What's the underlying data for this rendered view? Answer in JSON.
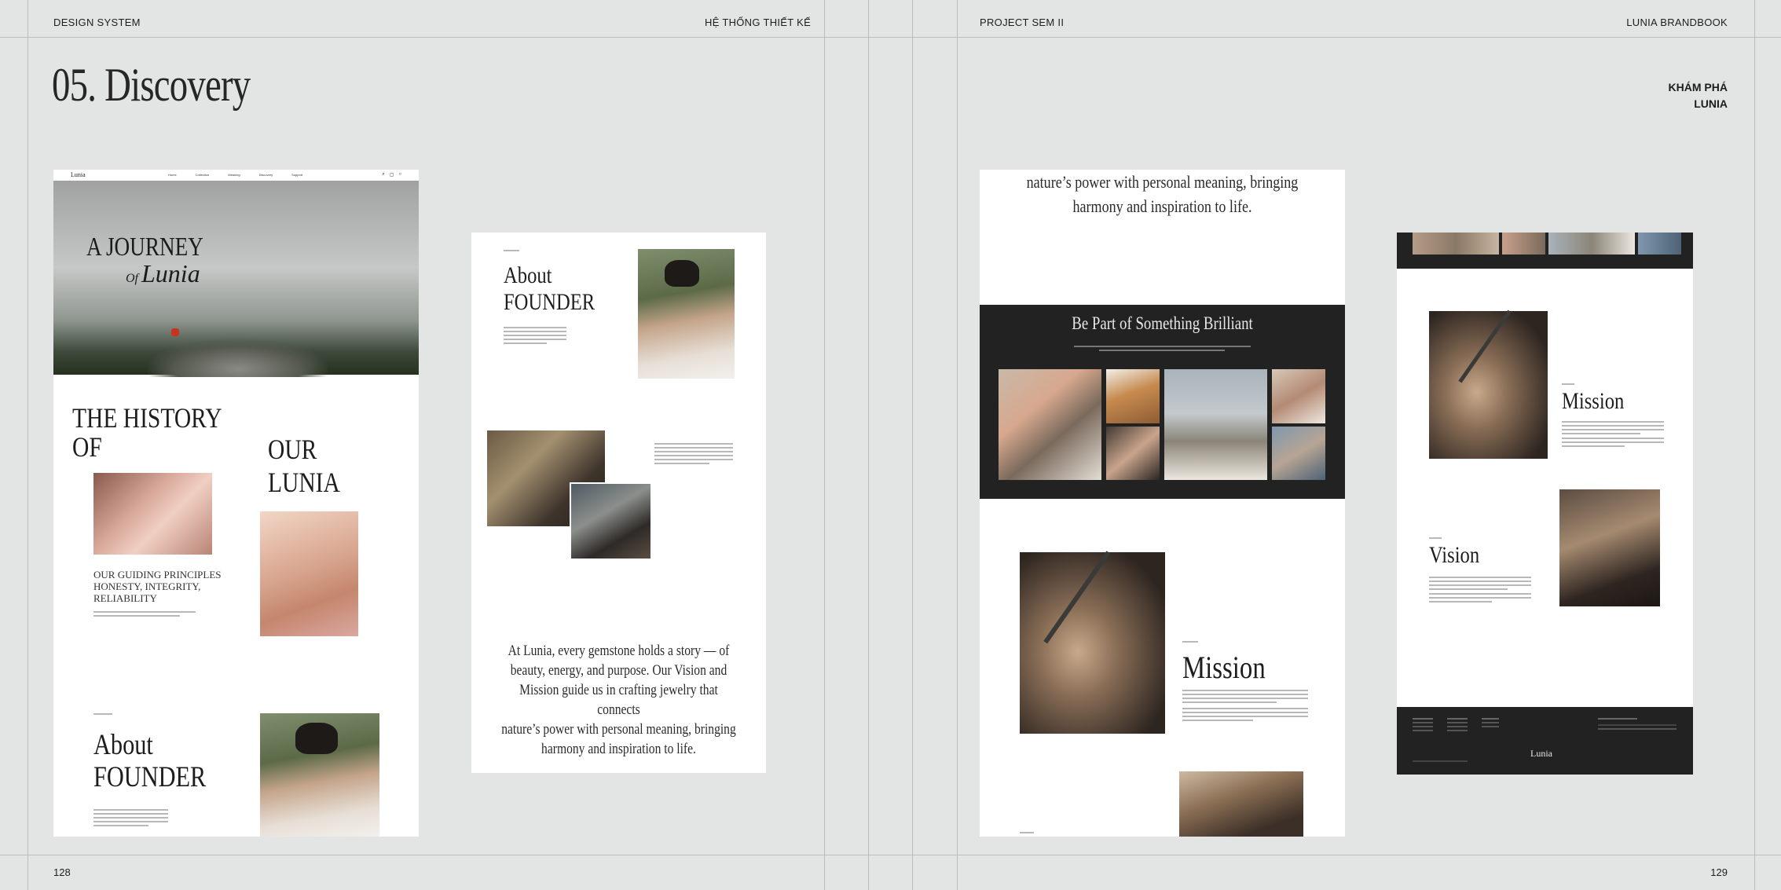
{
  "left_page": {
    "header_left": "DESIGN SYSTEM",
    "header_right": "HỆ THỐNG THIẾT KẾ",
    "title": "05. Discovery",
    "page_number": "128"
  },
  "right_page": {
    "header_left": "PROJECT SEM II",
    "header_right": "LUNIA BRANDBOOK",
    "subtitle_line1": "KHÁM PHÁ",
    "subtitle_line2": "LUNIA",
    "page_number": "129"
  },
  "mock1": {
    "logo": "Lunia",
    "nav": [
      "Home",
      "Collection",
      "Meaning",
      "Discovery",
      "Support"
    ],
    "hero_line1": "A JOURNEY",
    "hero_of": "Of",
    "hero_lunia": "Lunia",
    "history_line1": "THE HISTORY",
    "history_line2": "OF",
    "our_lunia": "OUR LUNIA",
    "principles": [
      "OUR GUIDING PRINCIPLES",
      "HONESTY, INTEGRITY,",
      "RELIABILITY"
    ],
    "about_line1": "About",
    "about_line2": "FOUNDER"
  },
  "mock2": {
    "about_line1": "About",
    "about_line2": "FOUNDER",
    "quote_lines": [
      "At Lunia, every gemstone holds a story — of",
      "beauty, energy, and purpose. Our Vision and",
      "Mission guide us in crafting jewelry that connects",
      "nature’s power with personal meaning, bringing",
      "harmony and inspiration to life."
    ]
  },
  "mock3": {
    "quote_lines": [
      "nature’s power with personal meaning, bringing",
      "harmony and inspiration to life."
    ],
    "band_title": "Be Part of Something Brilliant",
    "mission_title": "Mission"
  },
  "mock4": {
    "mission_title": "Mission",
    "vision_title": "Vision",
    "footer_logo": "Lunia"
  },
  "colors": {
    "background": "#e3e5e4",
    "grid_lines": "#b9bdbc",
    "dark_band": "#222222"
  }
}
